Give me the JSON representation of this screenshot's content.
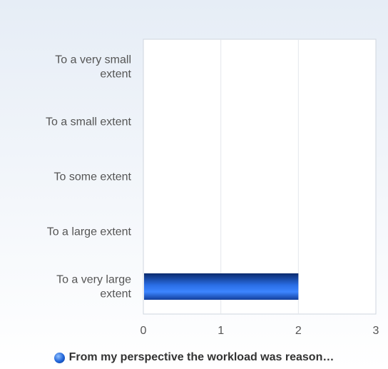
{
  "chart_data": {
    "type": "bar",
    "orientation": "horizontal",
    "categories": [
      "To a very small extent",
      "To a small extent",
      "To some extent",
      "To a large extent",
      "To a very large extent"
    ],
    "category_label_lines": [
      [
        "To a very small",
        "extent"
      ],
      [
        "To a small extent"
      ],
      [
        "To some extent"
      ],
      [
        "To a large extent"
      ],
      [
        "To a very large",
        "extent"
      ]
    ],
    "series": [
      {
        "name": "From my perspective the workload was reason…",
        "values": [
          0,
          0,
          0,
          0,
          2
        ],
        "color": "#1f63d8"
      }
    ],
    "xlim": [
      0,
      3
    ],
    "x_ticks": [
      "0",
      "1",
      "2",
      "3"
    ],
    "grid": true,
    "legend_position": "bottom"
  }
}
